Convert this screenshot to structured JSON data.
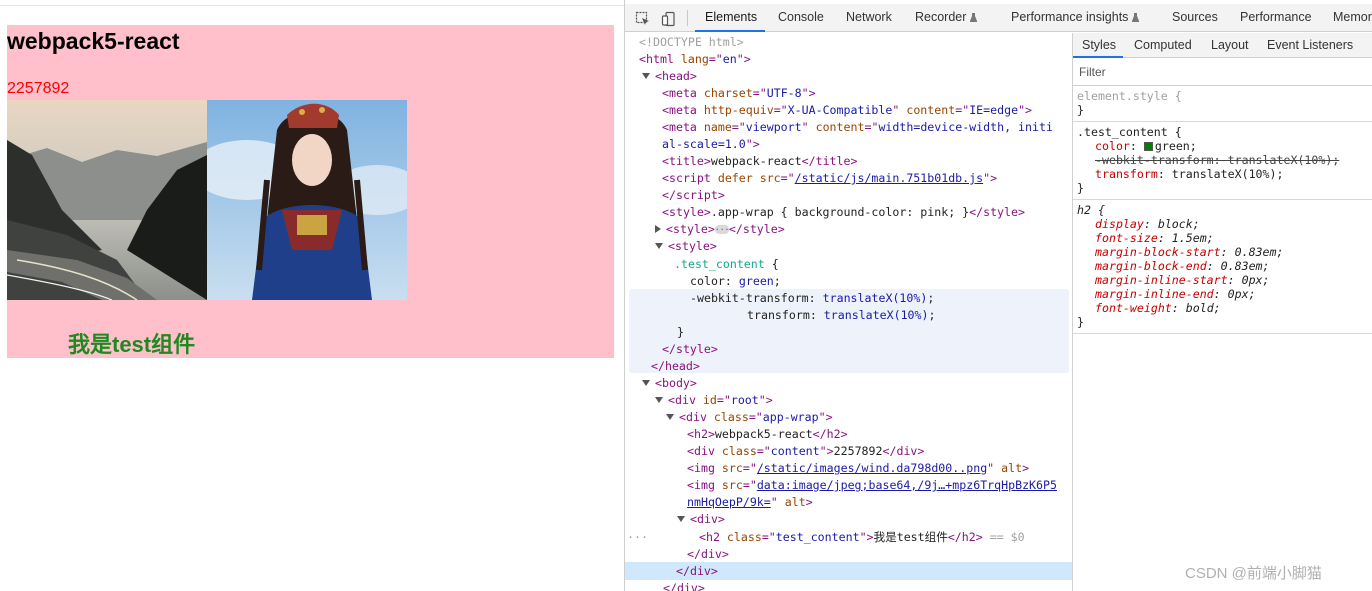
{
  "page": {
    "title": "webpack5-react",
    "content_number": "2257892",
    "test_component_text": "我是test组件",
    "colors": {
      "wrap_background": "#ffc0cb",
      "number": "#ff0000",
      "test_text": "#008000"
    }
  },
  "devtools": {
    "tabs": [
      "Elements",
      "Console",
      "Network",
      "Recorder",
      "Performance insights",
      "Sources",
      "Performance",
      "Memor"
    ],
    "active_tab": "Elements",
    "tree": {
      "doctype": "<!DOCTYPE html>",
      "html_open": "html",
      "html_lang": "en",
      "head": "head",
      "meta1_attr": "charset",
      "meta1_val": "UTF-8",
      "meta2_attr1": "http-equiv",
      "meta2_val1": "X-UA-Compatible",
      "meta2_attr2": "content",
      "meta2_val2": "IE=edge",
      "meta3_attr1": "name",
      "meta3_val1": "viewport",
      "meta3_attr2": "content",
      "meta3_val2a": "width=device-width, initi",
      "meta3_val2b": "al-scale=1.0",
      "title_text": "webpack-react",
      "script_src": "/static/js/main.751b01db.js",
      "style1_text": ".app-wrap { background-color: pink; }",
      "css_selector": ".test_content",
      "css_line1_prop": "color",
      "css_line1_val": "green",
      "css_line2_prop": "-webkit-transform",
      "css_line2_val": "translateX(10%)",
      "css_line3_prop": "transform",
      "css_line3_val": "translateX(10%)",
      "div_root_id": "root",
      "div_app_class": "app-wrap",
      "h2_text": "webpack5-react",
      "content_class": "content",
      "content_text": "2257892",
      "img1_src": "/static/images/wind.da798d00..png",
      "img2_src_a": "data:image/jpeg;base64,/9j…+mpz6TrqHpBzK6P5",
      "img2_src_b": "nmHqOepP/9k=",
      "h2_class": "test_content",
      "h2_sel_text": "我是test组件",
      "selected_marker": "== $0"
    }
  },
  "styles_pane": {
    "tabs": [
      "Styles",
      "Computed",
      "Layout",
      "Event Listeners"
    ],
    "active_tab": "Styles",
    "filter_placeholder": "Filter",
    "element_style": "element.style {",
    "rule_selector": ".test_content {",
    "rule_color_prop": "color",
    "rule_color_val": "green;",
    "rule_webkit_prop": "-webkit-transform",
    "rule_webkit_val": "translateX(10%);",
    "rule_transform_prop": "transform",
    "rule_transform_val": "translateX(10%);",
    "ua_selector": "h2 {",
    "ua_props": [
      {
        "prop": "display",
        "val": "block;"
      },
      {
        "prop": "font-size",
        "val": "1.5em;"
      },
      {
        "prop": "margin-block-start",
        "val": "0.83em;"
      },
      {
        "prop": "margin-block-end",
        "val": "0.83em;"
      },
      {
        "prop": "margin-inline-start",
        "val": "0px;"
      },
      {
        "prop": "margin-inline-end",
        "val": "0px;"
      },
      {
        "prop": "font-weight",
        "val": "bold;"
      }
    ],
    "close_brace": "}"
  },
  "watermark": "CSDN @前端小脚猫"
}
